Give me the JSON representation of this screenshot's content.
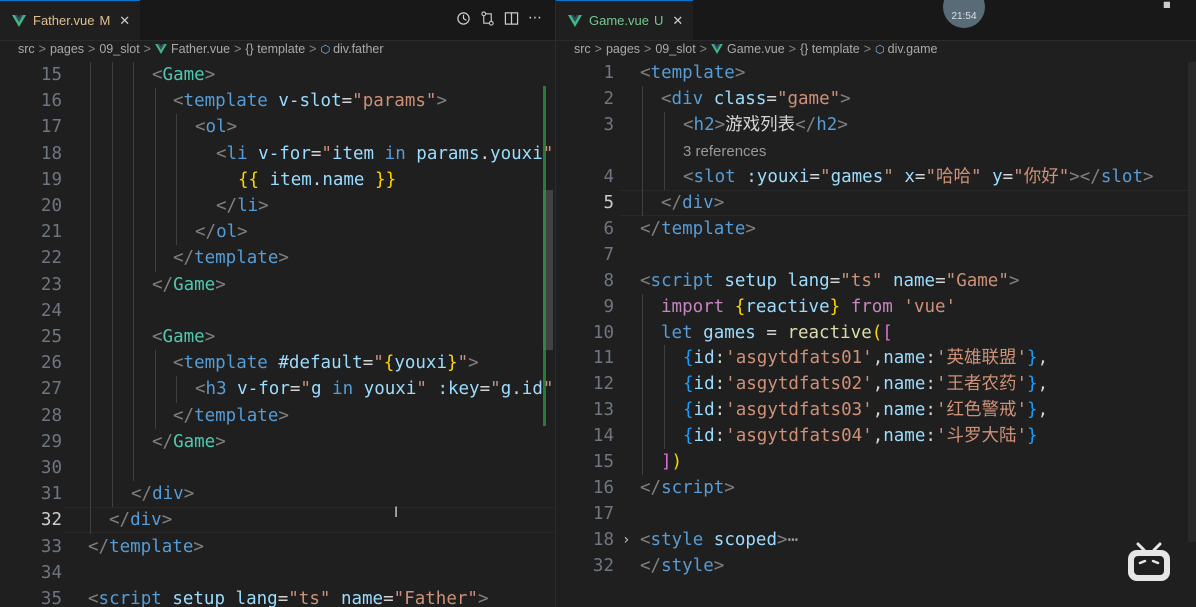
{
  "left": {
    "tab": {
      "name": "Father.vue",
      "status": "M",
      "close": "✕"
    },
    "actions": [
      "history-icon",
      "compare-icon",
      "split-editor-icon",
      "more-icon"
    ],
    "breadcrumb": [
      "src",
      "pages",
      "09_slot",
      "Father.vue",
      "{} template",
      "div.father"
    ],
    "lines": [
      {
        "n": "15",
        "tokens": [
          [
            "t-br",
            "<"
          ],
          [
            "t-comp",
            "Game"
          ],
          [
            "t-br",
            ">"
          ]
        ],
        "indent": 64
      },
      {
        "n": "16",
        "tokens": [
          [
            "t-br",
            "<"
          ],
          [
            "t-tag",
            "template"
          ],
          [
            "t-plain",
            " "
          ],
          [
            "t-attr",
            "v-slot"
          ],
          [
            "t-plain",
            "="
          ],
          [
            "t-str",
            "\"params\""
          ],
          [
            "t-br",
            ">"
          ]
        ],
        "indent": 85
      },
      {
        "n": "17",
        "tokens": [
          [
            "t-br",
            "<"
          ],
          [
            "t-tag",
            "ol"
          ],
          [
            "t-br",
            ">"
          ]
        ],
        "indent": 107
      },
      {
        "n": "18",
        "tokens": [
          [
            "t-br",
            "<"
          ],
          [
            "t-tag",
            "li"
          ],
          [
            "t-plain",
            " "
          ],
          [
            "t-attr",
            "v-for"
          ],
          [
            "t-plain",
            "="
          ],
          [
            "t-str",
            "\""
          ],
          [
            "t-var",
            "item"
          ],
          [
            "t-plain",
            " "
          ],
          [
            "t-kw",
            "in"
          ],
          [
            "t-plain",
            " "
          ],
          [
            "t-var",
            "params"
          ],
          [
            "t-plain",
            "."
          ],
          [
            "t-var",
            "youxi"
          ],
          [
            "t-str",
            "\""
          ]
        ],
        "indent": 128
      },
      {
        "n": "19",
        "tokens": [
          [
            "t-brace",
            "{{"
          ],
          [
            "t-plain",
            " "
          ],
          [
            "t-var",
            "item"
          ],
          [
            "t-plain",
            "."
          ],
          [
            "t-var",
            "name"
          ],
          [
            "t-plain",
            " "
          ],
          [
            "t-brace",
            "}}"
          ]
        ],
        "indent": 150
      },
      {
        "n": "20",
        "tokens": [
          [
            "t-br",
            "</"
          ],
          [
            "t-tag",
            "li"
          ],
          [
            "t-br",
            ">"
          ]
        ],
        "indent": 128
      },
      {
        "n": "21",
        "tokens": [
          [
            "t-br",
            "</"
          ],
          [
            "t-tag",
            "ol"
          ],
          [
            "t-br",
            ">"
          ]
        ],
        "indent": 107
      },
      {
        "n": "22",
        "tokens": [
          [
            "t-br",
            "</"
          ],
          [
            "t-tag",
            "template"
          ],
          [
            "t-br",
            ">"
          ]
        ],
        "indent": 85
      },
      {
        "n": "23",
        "tokens": [
          [
            "t-br",
            "</"
          ],
          [
            "t-comp",
            "Game"
          ],
          [
            "t-br",
            ">"
          ]
        ],
        "indent": 64
      },
      {
        "n": "24",
        "tokens": [],
        "indent": 64
      },
      {
        "n": "25",
        "tokens": [
          [
            "t-br",
            "<"
          ],
          [
            "t-comp",
            "Game"
          ],
          [
            "t-br",
            ">"
          ]
        ],
        "indent": 64
      },
      {
        "n": "26",
        "tokens": [
          [
            "t-br",
            "<"
          ],
          [
            "t-tag",
            "template"
          ],
          [
            "t-plain",
            " "
          ],
          [
            "t-attr",
            "#default"
          ],
          [
            "t-plain",
            "="
          ],
          [
            "t-str",
            "\""
          ],
          [
            "t-brace",
            "{"
          ],
          [
            "t-var",
            "youxi"
          ],
          [
            "t-brace",
            "}"
          ],
          [
            "t-str",
            "\""
          ],
          [
            "t-br",
            ">"
          ]
        ],
        "indent": 85
      },
      {
        "n": "27",
        "tokens": [
          [
            "t-br",
            "<"
          ],
          [
            "t-tag",
            "h3"
          ],
          [
            "t-plain",
            " "
          ],
          [
            "t-attr",
            "v-for"
          ],
          [
            "t-plain",
            "="
          ],
          [
            "t-str",
            "\""
          ],
          [
            "t-var",
            "g"
          ],
          [
            "t-plain",
            " "
          ],
          [
            "t-kw",
            "in"
          ],
          [
            "t-plain",
            " "
          ],
          [
            "t-var",
            "youxi"
          ],
          [
            "t-str",
            "\""
          ],
          [
            "t-plain",
            " "
          ],
          [
            "t-attr",
            ":key"
          ],
          [
            "t-plain",
            "="
          ],
          [
            "t-str",
            "\""
          ],
          [
            "t-var",
            "g"
          ],
          [
            "t-plain",
            "."
          ],
          [
            "t-var",
            "id"
          ],
          [
            "t-str",
            "\""
          ]
        ],
        "indent": 107
      },
      {
        "n": "28",
        "tokens": [
          [
            "t-br",
            "</"
          ],
          [
            "t-tag",
            "template"
          ],
          [
            "t-br",
            ">"
          ]
        ],
        "indent": 85
      },
      {
        "n": "29",
        "tokens": [
          [
            "t-br",
            "</"
          ],
          [
            "t-comp",
            "Game"
          ],
          [
            "t-br",
            ">"
          ]
        ],
        "indent": 64
      },
      {
        "n": "30",
        "tokens": [],
        "indent": 64
      },
      {
        "n": "31",
        "tokens": [
          [
            "t-br",
            "</"
          ],
          [
            "t-tag",
            "div"
          ],
          [
            "t-br",
            ">"
          ]
        ],
        "indent": 43
      },
      {
        "n": "32",
        "tokens": [
          [
            "t-br",
            "</"
          ],
          [
            "t-tag",
            "div"
          ],
          [
            "t-br",
            ">"
          ]
        ],
        "indent": 21,
        "active": true
      },
      {
        "n": "33",
        "tokens": [
          [
            "t-br",
            "</"
          ],
          [
            "t-tag",
            "template"
          ],
          [
            "t-br",
            ">"
          ]
        ],
        "indent": 0
      },
      {
        "n": "34",
        "tokens": [],
        "indent": 0
      },
      {
        "n": "35",
        "tokens": [
          [
            "t-br",
            "<"
          ],
          [
            "t-tag",
            "script"
          ],
          [
            "t-plain",
            " "
          ],
          [
            "t-attr",
            "setup"
          ],
          [
            "t-plain",
            " "
          ],
          [
            "t-attr",
            "lang"
          ],
          [
            "t-plain",
            "="
          ],
          [
            "t-str",
            "\"ts\""
          ],
          [
            "t-plain",
            " "
          ],
          [
            "t-attr",
            "name"
          ],
          [
            "t-plain",
            "="
          ],
          [
            "t-str",
            "\"Father\""
          ],
          [
            "t-br",
            ">"
          ]
        ],
        "indent": 0
      }
    ]
  },
  "right": {
    "tab": {
      "name": "Game.vue",
      "status": "U",
      "close": "✕"
    },
    "breadcrumb": [
      "src",
      "pages",
      "09_slot",
      "Game.vue",
      "{} template",
      "div.game"
    ],
    "codelens": "3 references",
    "lines": [
      {
        "n": "1",
        "tokens": [
          [
            "t-br",
            "<"
          ],
          [
            "t-tag",
            "template"
          ],
          [
            "t-br",
            ">"
          ]
        ],
        "indent": 0
      },
      {
        "n": "2",
        "tokens": [
          [
            "t-br",
            "<"
          ],
          [
            "t-tag",
            "div"
          ],
          [
            "t-plain",
            " "
          ],
          [
            "t-attr",
            "class"
          ],
          [
            "t-plain",
            "="
          ],
          [
            "t-str",
            "\"game\""
          ],
          [
            "t-br",
            ">"
          ]
        ],
        "indent": 21
      },
      {
        "n": "3",
        "tokens": [
          [
            "t-br",
            "<"
          ],
          [
            "t-tag",
            "h2"
          ],
          [
            "t-br",
            ">"
          ],
          [
            "t-plain",
            "游戏列表"
          ],
          [
            "t-br",
            "</"
          ],
          [
            "t-tag",
            "h2"
          ],
          [
            "t-br",
            ">"
          ]
        ],
        "indent": 43
      },
      {
        "n": "",
        "codelens": true,
        "indent": 43
      },
      {
        "n": "4",
        "tokens": [
          [
            "t-br",
            "<"
          ],
          [
            "t-tag",
            "slot"
          ],
          [
            "t-plain",
            " "
          ],
          [
            "t-attr",
            ":youxi"
          ],
          [
            "t-plain",
            "="
          ],
          [
            "t-str",
            "\""
          ],
          [
            "t-var",
            "games"
          ],
          [
            "t-str",
            "\""
          ],
          [
            "t-plain",
            " "
          ],
          [
            "t-attr",
            "x"
          ],
          [
            "t-plain",
            "="
          ],
          [
            "t-str",
            "\"哈哈\""
          ],
          [
            "t-plain",
            " "
          ],
          [
            "t-attr",
            "y"
          ],
          [
            "t-plain",
            "="
          ],
          [
            "t-str",
            "\"你好\""
          ],
          [
            "t-br",
            "></"
          ],
          [
            "t-tag",
            "slot"
          ],
          [
            "t-br",
            ">"
          ]
        ],
        "indent": 43
      },
      {
        "n": "5",
        "tokens": [
          [
            "t-br",
            "</"
          ],
          [
            "t-tag",
            "div"
          ],
          [
            "t-br",
            ">"
          ]
        ],
        "indent": 21,
        "active": true
      },
      {
        "n": "6",
        "tokens": [
          [
            "t-br",
            "</"
          ],
          [
            "t-tag",
            "template"
          ],
          [
            "t-br",
            ">"
          ]
        ],
        "indent": 0
      },
      {
        "n": "7",
        "tokens": [],
        "indent": 0
      },
      {
        "n": "8",
        "tokens": [
          [
            "t-br",
            "<"
          ],
          [
            "t-tag",
            "script"
          ],
          [
            "t-plain",
            " "
          ],
          [
            "t-attr",
            "setup"
          ],
          [
            "t-plain",
            " "
          ],
          [
            "t-attr",
            "lang"
          ],
          [
            "t-plain",
            "="
          ],
          [
            "t-str",
            "\"ts\""
          ],
          [
            "t-plain",
            " "
          ],
          [
            "t-attr",
            "name"
          ],
          [
            "t-plain",
            "="
          ],
          [
            "t-str",
            "\"Game\""
          ],
          [
            "t-br",
            ">"
          ]
        ],
        "indent": 0
      },
      {
        "n": "9",
        "tokens": [
          [
            "t-ctrl",
            "import"
          ],
          [
            "t-plain",
            " "
          ],
          [
            "t-brace",
            "{"
          ],
          [
            "t-var",
            "reactive"
          ],
          [
            "t-brace",
            "}"
          ],
          [
            "t-plain",
            " "
          ],
          [
            "t-ctrl",
            "from"
          ],
          [
            "t-plain",
            " "
          ],
          [
            "t-str",
            "'vue'"
          ]
        ],
        "indent": 21
      },
      {
        "n": "10",
        "tokens": [
          [
            "t-kw",
            "let"
          ],
          [
            "t-plain",
            " "
          ],
          [
            "t-var",
            "games"
          ],
          [
            "t-plain",
            " = "
          ],
          [
            "t-fn",
            "reactive"
          ],
          [
            "t-brace",
            "("
          ],
          [
            "t-brace2",
            "["
          ]
        ],
        "indent": 21
      },
      {
        "n": "11",
        "tokens": [
          [
            "t-brace3",
            "{"
          ],
          [
            "t-var",
            "id"
          ],
          [
            "t-plain",
            ":"
          ],
          [
            "t-str",
            "'asgytdfats01'"
          ],
          [
            "t-plain",
            ","
          ],
          [
            "t-var",
            "name"
          ],
          [
            "t-plain",
            ":"
          ],
          [
            "t-str",
            "'英雄联盟'"
          ],
          [
            "t-brace3",
            "}"
          ],
          [
            "t-plain",
            ","
          ]
        ],
        "indent": 43
      },
      {
        "n": "12",
        "tokens": [
          [
            "t-brace3",
            "{"
          ],
          [
            "t-var",
            "id"
          ],
          [
            "t-plain",
            ":"
          ],
          [
            "t-str",
            "'asgytdfats02'"
          ],
          [
            "t-plain",
            ","
          ],
          [
            "t-var",
            "name"
          ],
          [
            "t-plain",
            ":"
          ],
          [
            "t-str",
            "'王者农药'"
          ],
          [
            "t-brace3",
            "}"
          ],
          [
            "t-plain",
            ","
          ]
        ],
        "indent": 43
      },
      {
        "n": "13",
        "tokens": [
          [
            "t-brace3",
            "{"
          ],
          [
            "t-var",
            "id"
          ],
          [
            "t-plain",
            ":"
          ],
          [
            "t-str",
            "'asgytdfats03'"
          ],
          [
            "t-plain",
            ","
          ],
          [
            "t-var",
            "name"
          ],
          [
            "t-plain",
            ":"
          ],
          [
            "t-str",
            "'红色警戒'"
          ],
          [
            "t-brace3",
            "}"
          ],
          [
            "t-plain",
            ","
          ]
        ],
        "indent": 43
      },
      {
        "n": "14",
        "tokens": [
          [
            "t-brace3",
            "{"
          ],
          [
            "t-var",
            "id"
          ],
          [
            "t-plain",
            ":"
          ],
          [
            "t-str",
            "'asgytdfats04'"
          ],
          [
            "t-plain",
            ","
          ],
          [
            "t-var",
            "name"
          ],
          [
            "t-plain",
            ":"
          ],
          [
            "t-str",
            "'斗罗大陆'"
          ],
          [
            "t-brace3",
            "}"
          ]
        ],
        "indent": 43
      },
      {
        "n": "15",
        "tokens": [
          [
            "t-brace2",
            "]"
          ],
          [
            "t-brace",
            ")"
          ]
        ],
        "indent": 21
      },
      {
        "n": "16",
        "tokens": [
          [
            "t-br",
            "</"
          ],
          [
            "t-tag",
            "script"
          ],
          [
            "t-br",
            ">"
          ]
        ],
        "indent": 0
      },
      {
        "n": "17",
        "tokens": [],
        "indent": 0
      },
      {
        "n": "18",
        "tokens": [
          [
            "t-br",
            "<"
          ],
          [
            "t-tag",
            "style"
          ],
          [
            "t-plain",
            " "
          ],
          [
            "t-attr",
            "scoped"
          ],
          [
            "t-br",
            ">"
          ],
          [
            "t-ellipsis",
            "⋯"
          ]
        ],
        "indent": 0,
        "fold": true
      },
      {
        "n": "32",
        "tokens": [
          [
            "t-br",
            "</"
          ],
          [
            "t-tag",
            "style"
          ],
          [
            "t-br",
            ">"
          ]
        ],
        "indent": 0
      }
    ]
  },
  "overlay": {
    "timer": "21:54"
  }
}
